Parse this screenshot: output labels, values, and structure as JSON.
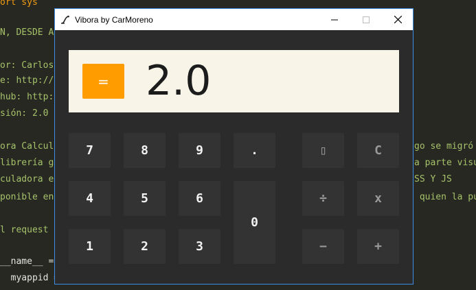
{
  "background_code": [
    {
      "text": "ort sys",
      "color": "orange"
    },
    {
      "text": "",
      "color": "white"
    },
    {
      "text": "N, DESDE A",
      "color": "green"
    },
    {
      "text": "",
      "color": "white"
    },
    {
      "text": "or: Carlos",
      "color": "green"
    },
    {
      "text": "e: http://",
      "color": "green"
    },
    {
      "text": "hub: http:",
      "color": "green"
    },
    {
      "text": "sión: 2.0",
      "color": "green"
    },
    {
      "text": "",
      "color": "white"
    },
    {
      "text": "ora Calcul",
      "color": "green"
    },
    {
      "text": "librería g",
      "color": "green"
    },
    {
      "text": "culadora e",
      "color": "green"
    },
    {
      "text": "ponible en",
      "color": "green"
    },
    {
      "text": "",
      "color": "white"
    },
    {
      "text": "l request",
      "color": "green"
    },
    {
      "text": "",
      "color": "white"
    },
    {
      "text": "__name__ =",
      "color": "white"
    },
    {
      "text": "  myappid =",
      "color": "white"
    }
  ],
  "background_code_right": [
    {
      "text": "go se migró",
      "color": "green"
    },
    {
      "text": "a parte visu",
      "color": "green"
    },
    {
      "text": "SS Y JS",
      "color": "green"
    },
    {
      "text": " quien la pu",
      "color": "green"
    }
  ],
  "window": {
    "title": "Vibora by CarMoreno"
  },
  "display": {
    "equals_label": "=",
    "value": "2.0"
  },
  "keys": {
    "k7": "7",
    "k8": "8",
    "k9": "9",
    "dot": ".",
    "k4": "4",
    "k5": "5",
    "k6": "6",
    "k0": "0",
    "k1": "1",
    "k2": "2",
    "k3": "3",
    "unknown": "▯",
    "clear": "C",
    "divide": "÷",
    "multiply": "x",
    "minus": "−",
    "plus": "+"
  },
  "colors": {
    "accent": "#ff9c00",
    "window_border": "#3c8ee6",
    "display_bg": "#f8f4e8",
    "key_bg": "#333333"
  }
}
